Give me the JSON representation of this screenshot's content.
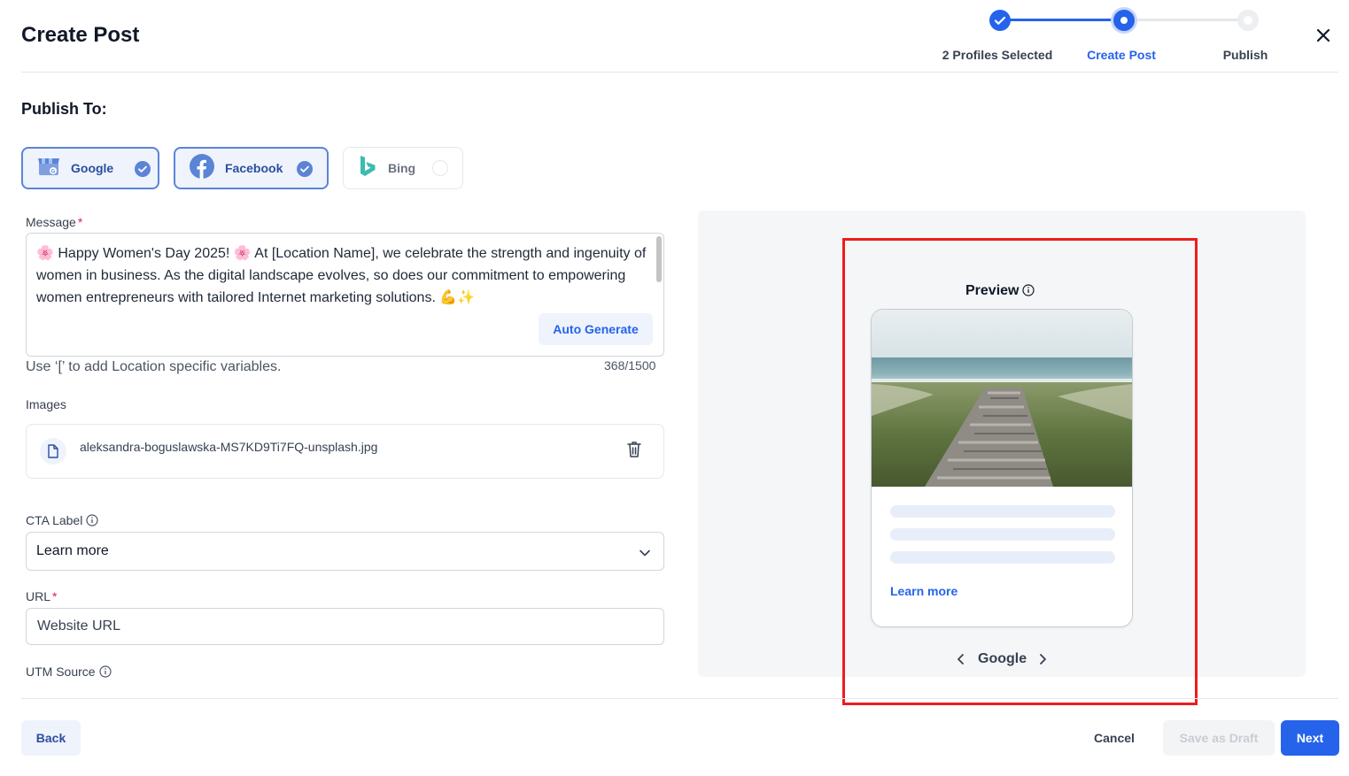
{
  "header": {
    "title": "Create Post",
    "steps": [
      {
        "label": "2 Profiles Selected",
        "state": "complete"
      },
      {
        "label": "Create Post",
        "state": "active"
      },
      {
        "label": "Publish",
        "state": "pending"
      }
    ]
  },
  "publish_to": {
    "heading": "Publish To:",
    "channels": [
      {
        "label": "Google",
        "selected": true,
        "icon": "google-business-icon"
      },
      {
        "label": "Facebook",
        "selected": true,
        "icon": "facebook-icon"
      },
      {
        "label": "Bing",
        "selected": false,
        "icon": "bing-icon"
      }
    ]
  },
  "message": {
    "label": "Message",
    "required_mark": "*",
    "text": "🌸 Happy Women's Day 2025! 🌸 At [Location Name], we celebrate the strength and ingenuity of women in business. As the digital landscape evolves, so does our commitment to empowering women entrepreneurs with tailored Internet marketing solutions. 💪✨",
    "auto_generate_label": "Auto Generate",
    "hint": "Use ‘[’ to add Location specific variables.",
    "counter": "368/1500"
  },
  "images": {
    "label": "Images",
    "file_name": "aleksandra-boguslawska-MS7KD9Ti7FQ-unsplash.jpg"
  },
  "cta": {
    "label": "CTA Label",
    "selected": "Learn more"
  },
  "url": {
    "label": "URL",
    "required_mark": "*",
    "placeholder": "Website URL"
  },
  "utm": {
    "label": "UTM Source"
  },
  "preview": {
    "title": "Preview",
    "cta_text": "Learn more",
    "platform": "Google"
  },
  "footer": {
    "back_label": "Back",
    "cancel_label": "Cancel",
    "draft_label": "Save as Draft",
    "next_label": "Next"
  },
  "colors": {
    "primary": "#2563eb",
    "highlight_box": "#ee1c1c",
    "selected_border": "#5b84d6"
  }
}
